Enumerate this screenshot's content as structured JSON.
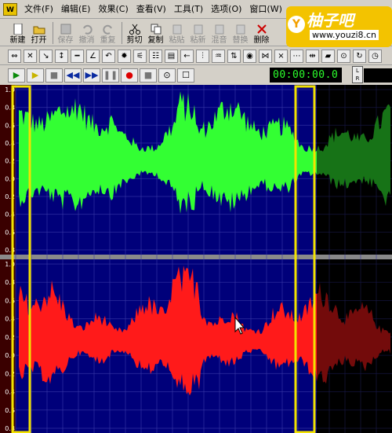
{
  "menu": {
    "app_icon": "W",
    "items": [
      "文件(F)",
      "编辑(E)",
      "效果(C)",
      "查看(V)",
      "工具(T)",
      "选项(O)",
      "窗口(W)"
    ]
  },
  "watermark": {
    "circle": "Y",
    "title": "柚子吧",
    "url": "www.youzi8.cn"
  },
  "toolbar": {
    "new": "新建",
    "open": "打开",
    "save": "保存",
    "undo": "撤消",
    "redo": "重复",
    "cut": "剪切",
    "copy": "复制",
    "paste": "粘贴",
    "paste_new": "粘新",
    "mix": "混音",
    "replace": "替换",
    "delete": "删除"
  },
  "transport": {
    "time": "00:00:00.0",
    "channel_l": "L",
    "channel_r": "R"
  },
  "waveform": {
    "left_channel_color": "#33ff33",
    "right_channel_color": "#ff1a1a",
    "dimmed_left_color": "#0a5a0a",
    "dimmed_right_color": "#5c0a0a",
    "background_color": "#00007a",
    "selection_color": "#f2e200",
    "scale_top": [
      "1.0",
      "0.8",
      "0.6",
      "0.4",
      "0.2",
      "0.0",
      "0.2",
      "0.4",
      "0.6",
      "0.8"
    ],
    "scale_bottom": [
      "1.0",
      "0.8",
      "0.6",
      "0.4",
      "0.2",
      "0.0",
      "0.2",
      "0.4",
      "0.6",
      "0.8"
    ]
  }
}
